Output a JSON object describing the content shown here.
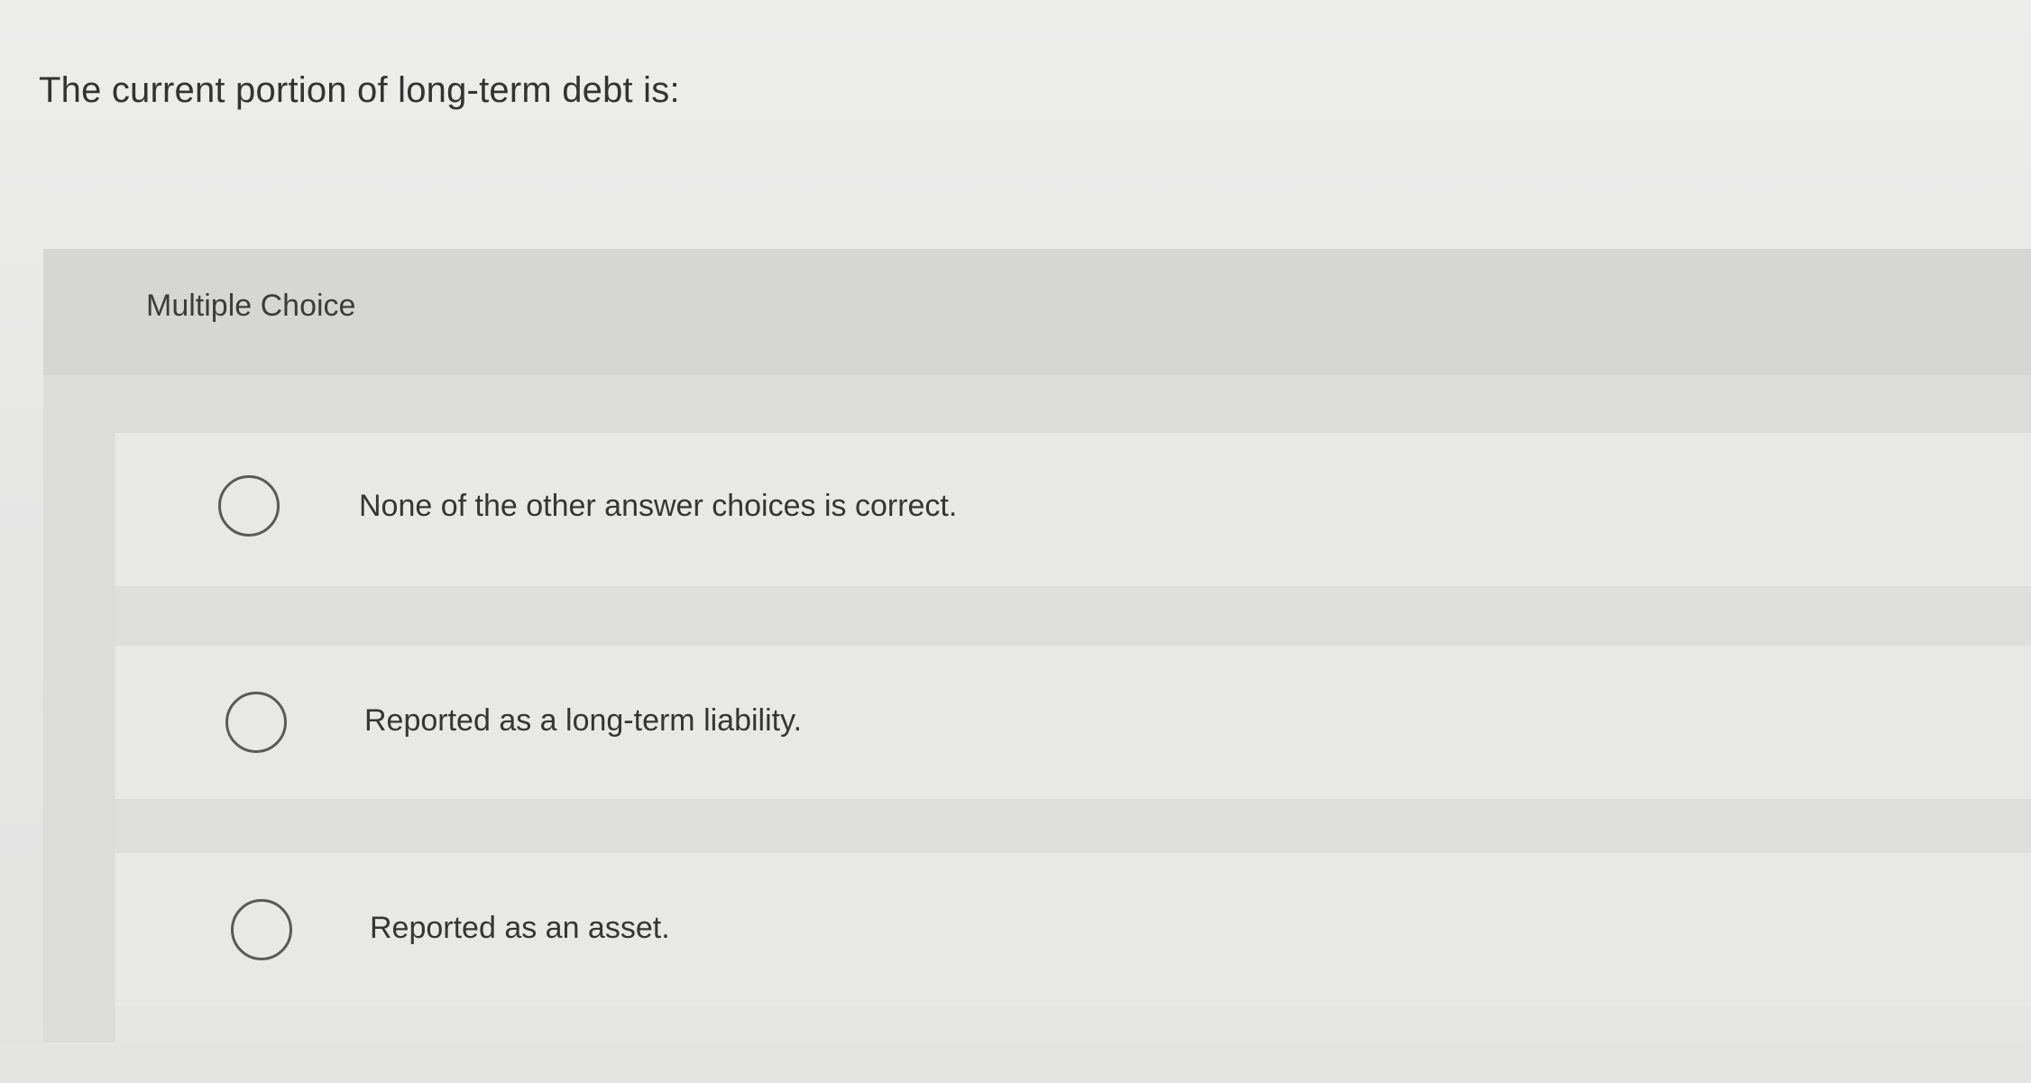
{
  "question": {
    "text": "The current portion of long-term debt is:"
  },
  "multiple_choice": {
    "label": "Multiple Choice",
    "options": [
      {
        "label": "None of the other answer choices is correct.",
        "selected": false
      },
      {
        "label": "Reported as a long-term liability.",
        "selected": false
      },
      {
        "label": "Reported as an asset.",
        "selected": false
      }
    ]
  }
}
